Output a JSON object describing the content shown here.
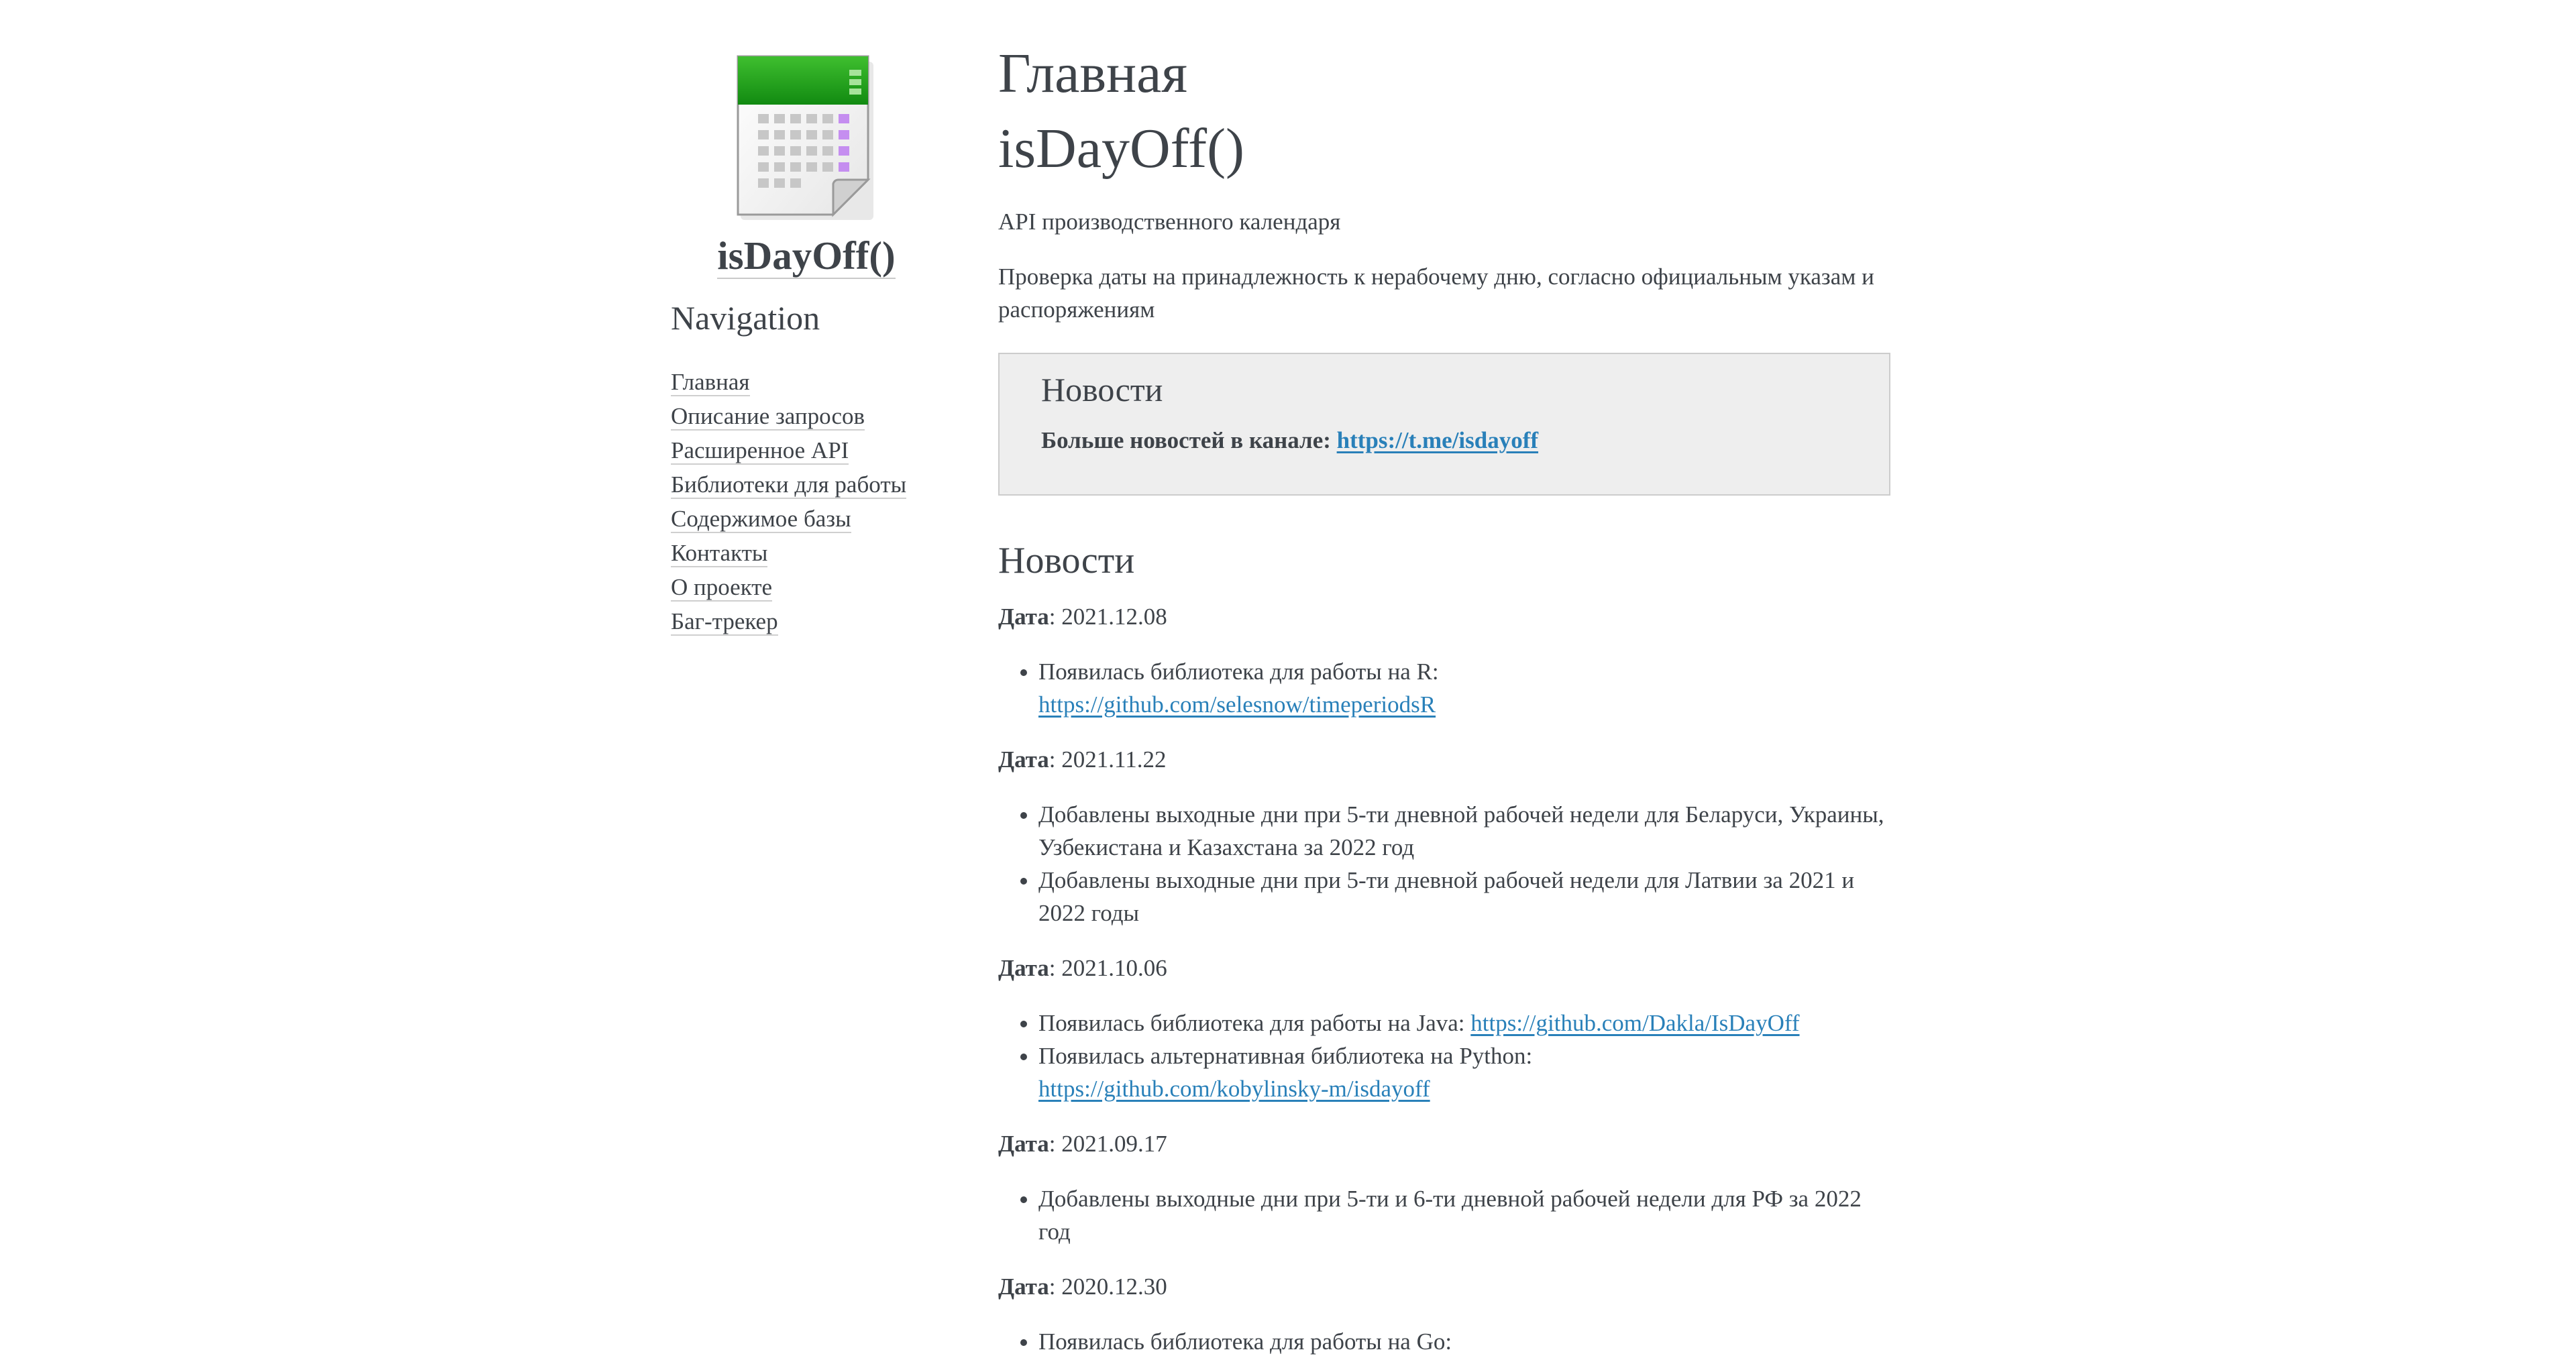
{
  "sidebar": {
    "logo_title": "isDayOff()",
    "nav_heading": "Navigation",
    "nav_items": [
      "Главная",
      "Описание запросов",
      "Расширенное API",
      "Библиотеки для работы",
      "Содержимое базы",
      "Контакты",
      "О проекте",
      "Баг-трекер"
    ]
  },
  "main": {
    "title_line1": "Главная",
    "title_line2": "isDayOff()",
    "subtitle": "API производственного календаря",
    "description": "Проверка даты на принадлежность к нерабочему дню, согласно официальным указам и распоряжениям",
    "admonition": {
      "title": "Новости",
      "text": "Больше новостей в канале:",
      "link": "https://t.me/isdayoff"
    },
    "news_title": "Новости",
    "date_label": "Дата",
    "news": [
      {
        "date": "2021.12.08",
        "items": [
          {
            "text": "Появилась библиотека для работы на R:",
            "link": "https://github.com/selesnow/timeperiodsR"
          }
        ]
      },
      {
        "date": "2021.11.22",
        "items": [
          {
            "text": "Добавлены выходные дни при 5-ти дневной рабочей недели для Беларуси, Украины, Узбекистана и Казахстана за 2022 год",
            "link": ""
          },
          {
            "text": "Добавлены выходные дни при 5-ти дневной рабочей недели для Латвии за 2021 и 2022 годы",
            "link": ""
          }
        ]
      },
      {
        "date": "2021.10.06",
        "items": [
          {
            "text": "Появилась библиотека для работы на Java:",
            "link": "https://github.com/Dakla/IsDayOff"
          },
          {
            "text": "Появилась альтернативная библиотека на Python:",
            "link": "https://github.com/kobylinsky-m/isdayoff"
          }
        ]
      },
      {
        "date": "2021.09.17",
        "items": [
          {
            "text": "Добавлены выходные дни при 5-ти и 6-ти дневной рабочей недели для РФ за 2022 год",
            "link": ""
          }
        ]
      },
      {
        "date": "2020.12.30",
        "items": [
          {
            "text": "Появилась библиотека для работы на Go:",
            "link": ""
          }
        ]
      }
    ]
  },
  "colors": {
    "text": "#3e4349",
    "link": "#2980b9",
    "admonition_bg": "#eeeeee",
    "admonition_border": "#cccccc",
    "logo_green": "#1e9b1e"
  }
}
